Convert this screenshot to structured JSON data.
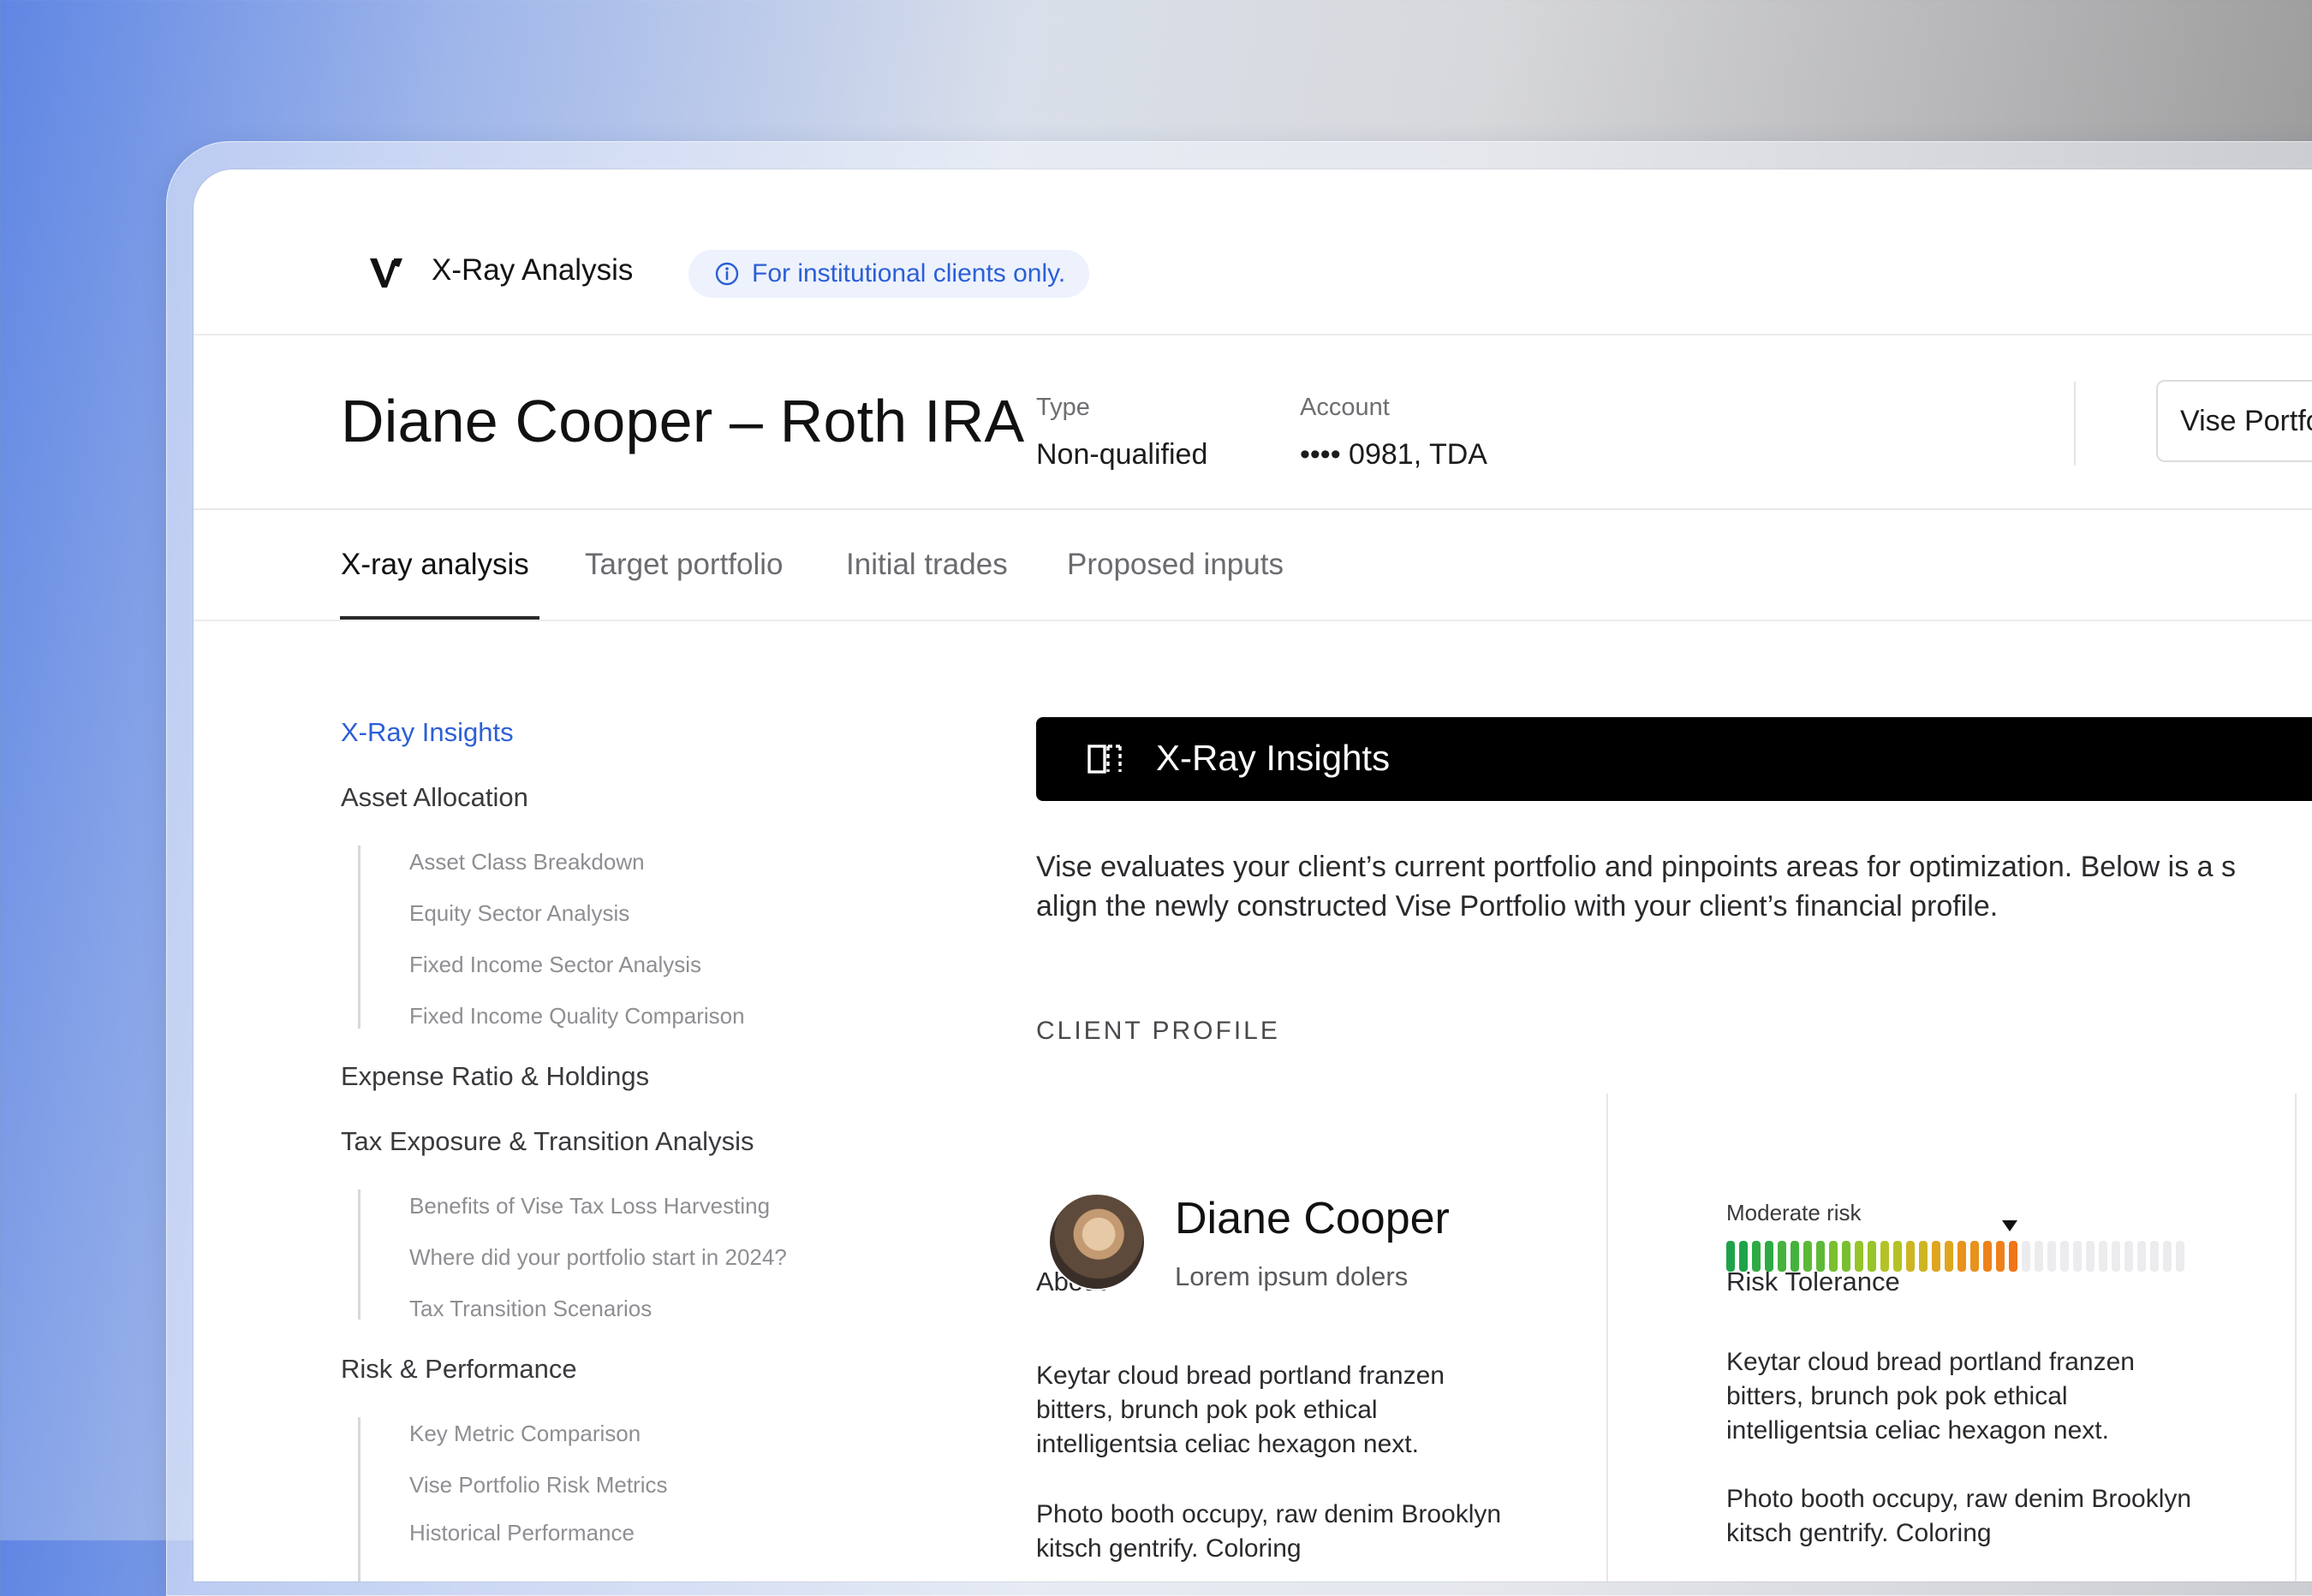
{
  "app": {
    "title": "X-Ray Analysis",
    "notice": "For institutional clients only."
  },
  "header": {
    "client_title": "Diane Cooper – Roth IRA",
    "type_label": "Type",
    "type_value": "Non-qualified",
    "account_label": "Account",
    "account_value": "•••• 0981, TDA",
    "action_button": "Vise Portfo"
  },
  "tabs": [
    {
      "label": "X-ray analysis",
      "active": true
    },
    {
      "label": "Target portfolio",
      "active": false
    },
    {
      "label": "Initial trades",
      "active": false
    },
    {
      "label": "Proposed inputs",
      "active": false
    }
  ],
  "sidebar": {
    "sections": [
      {
        "label": "X-Ray Insights",
        "active": true,
        "items": []
      },
      {
        "label": "Asset Allocation",
        "active": false,
        "items": [
          "Asset Class Breakdown",
          "Equity Sector Analysis",
          "Fixed Income Sector Analysis",
          "Fixed Income Quality Comparison"
        ]
      },
      {
        "label": "Expense Ratio & Holdings",
        "active": false,
        "items": []
      },
      {
        "label": "Tax Exposure & Transition Analysis",
        "active": false,
        "items": [
          "Benefits of Vise Tax Loss Harvesting",
          "Where did your portfolio start in 2024?",
          "Tax Transition Scenarios"
        ]
      },
      {
        "label": "Risk & Performance",
        "active": false,
        "items": [
          "Key Metric Comparison",
          "Vise Portfolio Risk Metrics",
          "Historical Performance"
        ]
      }
    ]
  },
  "insights": {
    "title": "X-Ray Insights",
    "intro_line1": "Vise evaluates your client’s current portfolio and pinpoints areas for optimization. Below is a s",
    "intro_line2": "align the newly constructed Vise Portfolio with your client’s financial profile."
  },
  "client_profile": {
    "section_label": "CLIENT PROFILE",
    "about": {
      "title": "About",
      "name": "Diane Cooper",
      "subtitle": "Lorem ipsum dolers",
      "para1": "Keytar cloud bread portland franzen bitters, brunch pok pok ethical intelligentsia celiac hexagon next.",
      "para2": "Photo booth occupy, raw denim Brooklyn kitsch gentrify. Coloring"
    },
    "risk": {
      "title": "Risk Tolerance",
      "level_label": "Moderate risk",
      "filled_segments": 23,
      "total_segments": 36,
      "para1": "Keytar cloud bread portland franzen bitters, brunch pok pok ethical intelligentsia celiac hexagon next.",
      "para2": "Photo booth occupy, raw denim Brooklyn kitsch gentrify. Coloring"
    }
  },
  "colors": {
    "accent": "#2c5fd6",
    "notice_bg": "#edf2fd",
    "insights_bar": "#000000"
  }
}
